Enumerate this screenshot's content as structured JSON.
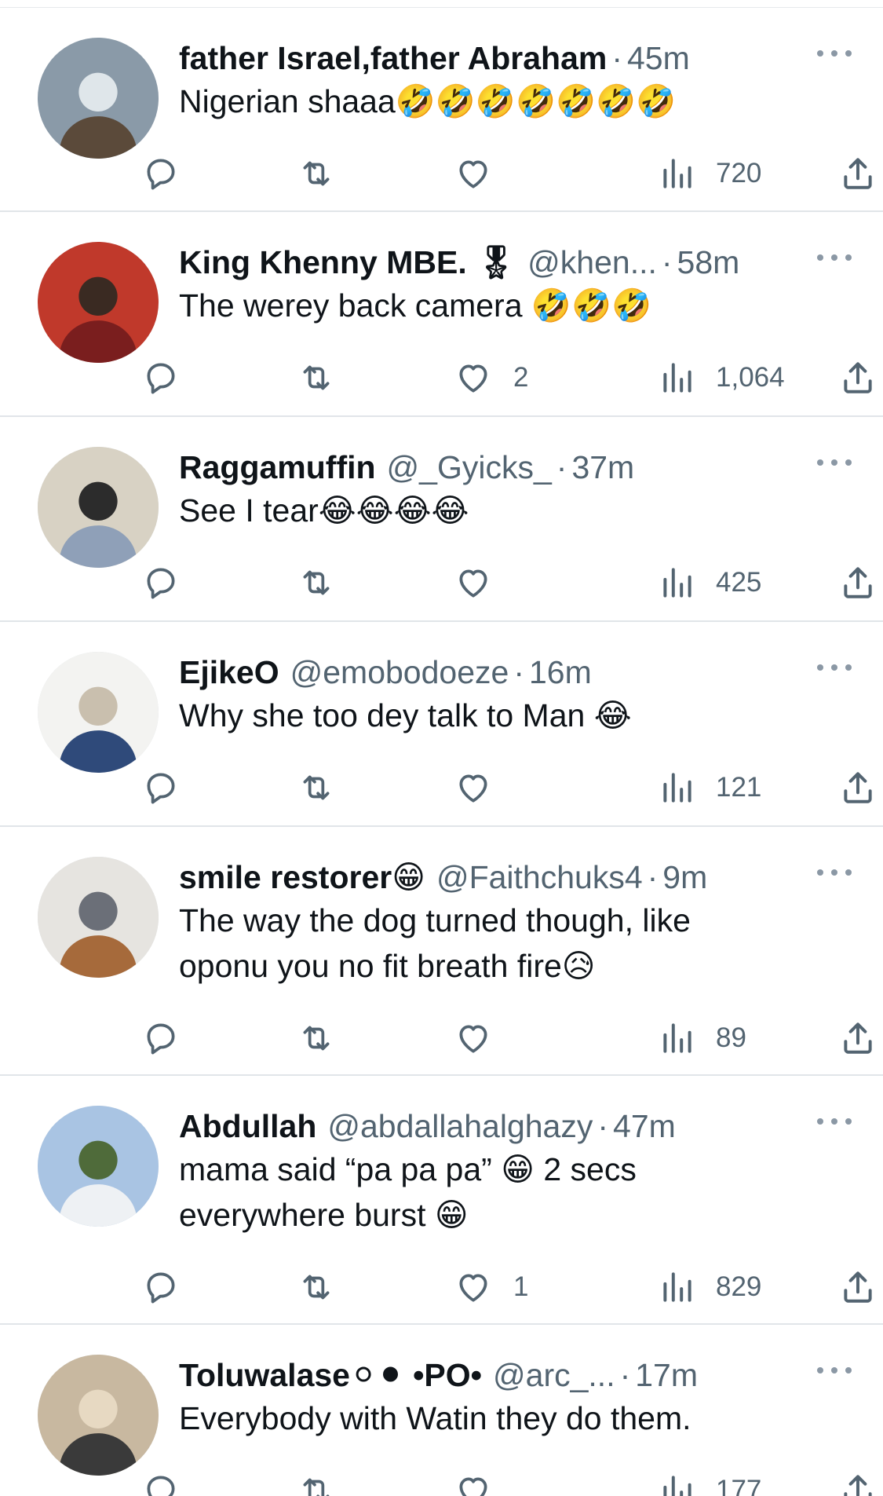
{
  "tweets": [
    {
      "name": "father Israel,father Abraham",
      "handle": "",
      "time": "45m",
      "text": "Nigerian shaaa🤣🤣🤣🤣🤣🤣🤣",
      "likes": "",
      "views": "720",
      "avatar_colors": [
        "#8a9aa8",
        "#5b4a3a",
        "#dfe6ea"
      ]
    },
    {
      "name": "King Khenny MBE. 🎖",
      "handle": "@khen...",
      "time": "58m",
      "text": "The werey back camera 🤣🤣🤣",
      "likes": "2",
      "views": "1,064",
      "avatar_colors": [
        "#c0392b",
        "#7a1e1e",
        "#3a2a22"
      ]
    },
    {
      "name": "Raggamuffin",
      "handle": "@_Gyicks_",
      "time": "37m",
      "text": "See I tear😂😂😂😂",
      "likes": "",
      "views": "425",
      "avatar_colors": [
        "#d8d2c4",
        "#8fa0b8",
        "#2c2c2c"
      ]
    },
    {
      "name": "EjikeO",
      "handle": "@emobodoeze",
      "time": "16m",
      "text": "Why she too dey talk to Man 😂",
      "likes": "",
      "views": "121",
      "avatar_colors": [
        "#f3f3f1",
        "#2f4a7a",
        "#c9bfae"
      ]
    },
    {
      "name": "smile restorer😁",
      "handle": "@Faithchuks4",
      "time": "9m",
      "text": "The way the dog turned though, like\noponu you no fit breath fire😥",
      "likes": "",
      "views": "89",
      "avatar_colors": [
        "#e6e4e0",
        "#a66a3b",
        "#6b6f78"
      ]
    },
    {
      "name": "Abdullah",
      "handle": "@abdallahalghazy",
      "time": "47m",
      "text": "mama said “pa pa pa” 😁 2 secs\neverywhere burst 😁",
      "likes": "1",
      "views": "829",
      "avatar_colors": [
        "#a9c4e3",
        "#eef1f4",
        "#4f6b3a"
      ]
    },
    {
      "name": "Toluwalase⚪⚫ •PO•",
      "handle": "@arc_...",
      "time": "17m",
      "text": "Everybody with Watin they do them.",
      "likes": "",
      "views": "177",
      "avatar_colors": [
        "#c8b8a0",
        "#3a3a3a",
        "#e7d9c2"
      ]
    }
  ],
  "icons": {
    "reply": "reply-icon",
    "retweet": "retweet-icon",
    "like": "heart-icon",
    "views": "views-icon",
    "share": "share-icon",
    "more": "more-icon"
  },
  "colors": {
    "text": "#0f1419",
    "secondary": "#536471",
    "divider": "#e1e5e9"
  }
}
